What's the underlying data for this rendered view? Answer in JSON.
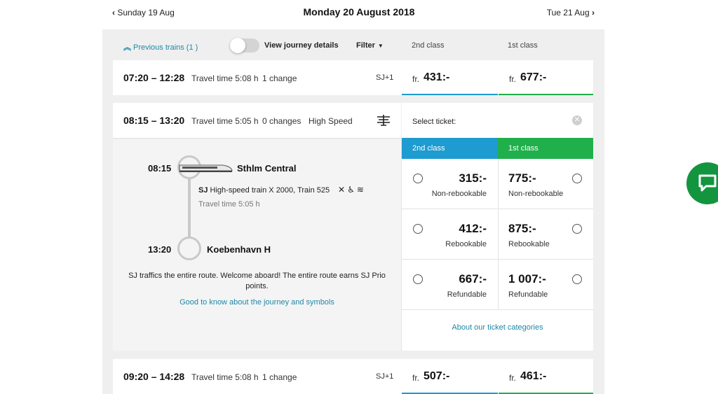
{
  "nav": {
    "prev_day": "Sunday 19 Aug",
    "current_date": "Monday 20 August 2018",
    "next_day": "Tue 21 Aug"
  },
  "toolbar": {
    "previous_trains": "Previous trains (1 )",
    "view_details": "View journey details",
    "toggle_on": false,
    "filter": "Filter",
    "class_2nd": "2nd class",
    "class_1st": "1st class"
  },
  "journeys": [
    {
      "times": "07:20 – 12:28",
      "travel_time": "Travel time 5:08 h",
      "changes": "1 change",
      "operator": "SJ+1",
      "price_prefix": "fr.",
      "price_2nd": "431:-",
      "price_1st": "677:-"
    },
    {
      "times": "08:15 – 13:20",
      "travel_time": "Travel time 5:05 h",
      "changes": "0 changes",
      "type": "High Speed",
      "operator_icon": "sj-logo-icon"
    },
    {
      "times": "09:20 – 14:28",
      "travel_time": "Travel time 5:08 h",
      "changes": "1 change",
      "operator": "SJ+1",
      "price_prefix": "fr.",
      "price_2nd": "507:-",
      "price_1st": "461:-"
    }
  ],
  "details": {
    "dep_time": "08:15",
    "dep_station": "Sthlm Central",
    "operator": "SJ",
    "train": "High-speed train X 2000, Train 525",
    "amenities": [
      "no-food-icon",
      "wheelchair-icon",
      "wifi-icon"
    ],
    "travel_time": "Travel time 5:05 h",
    "arr_time": "13:20",
    "arr_station": "Koebenhavn H",
    "info": "SJ traffics the entire route. Welcome aboard! The entire route earns SJ Prio points.",
    "link": "Good to know about the journey and symbols"
  },
  "tickets": {
    "select_label": "Select ticket:",
    "tab_2nd": "2nd class",
    "tab_1st": "1st class",
    "options": [
      {
        "price_2nd": "315:-",
        "price_1st": "775:-",
        "label": "Non-rebookable"
      },
      {
        "price_2nd": "412:-",
        "price_1st": "875:-",
        "label": "Rebookable"
      },
      {
        "price_2nd": "667:-",
        "price_1st": "1 007:-",
        "label": "Refundable"
      }
    ],
    "categories_link": "About our ticket categories"
  },
  "colors": {
    "accent_2nd": "#1e9bd0",
    "accent_1st": "#20b04b",
    "link": "#1e88a8",
    "chat": "#13953f"
  }
}
